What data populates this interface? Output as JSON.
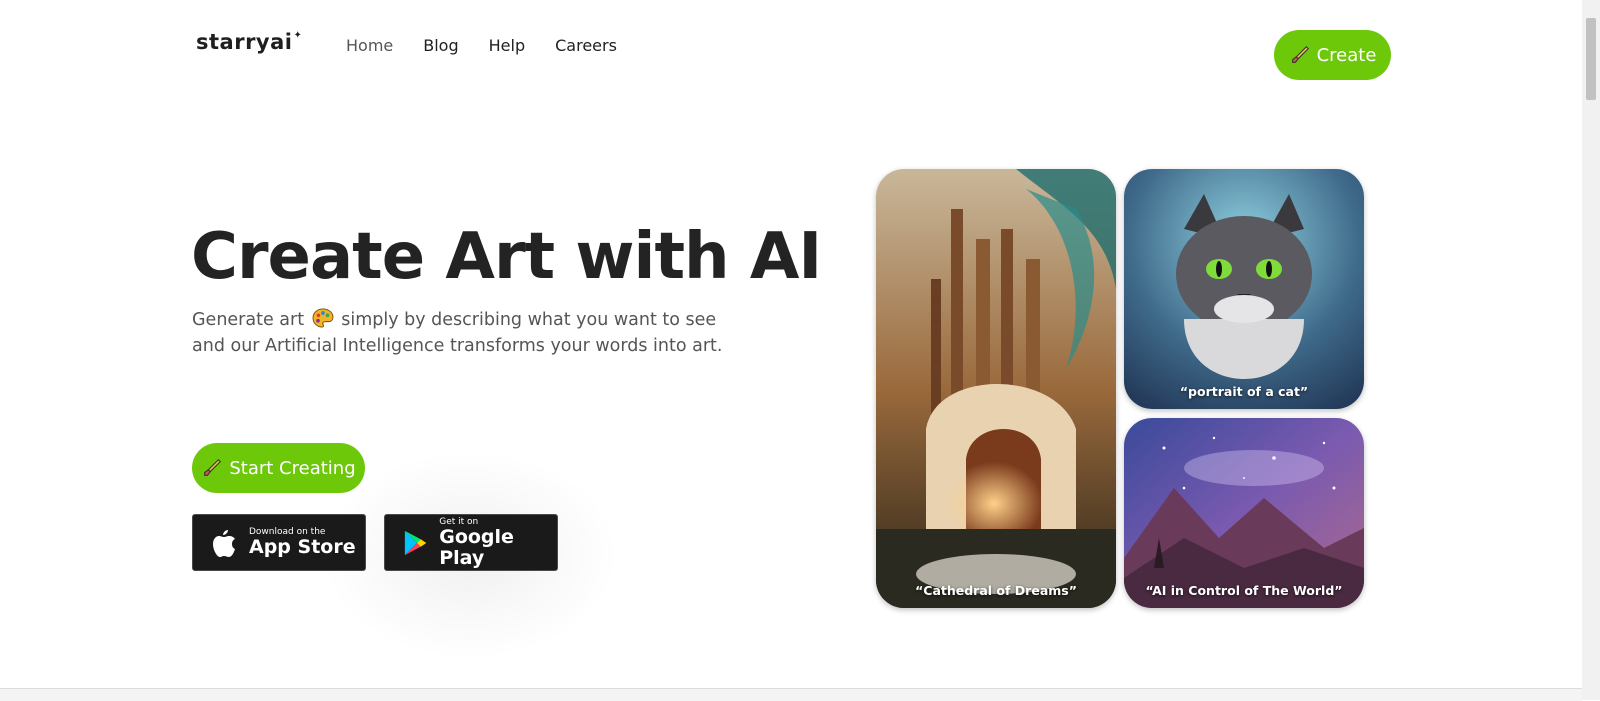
{
  "brand": {
    "name": "starryai",
    "star": "✦"
  },
  "nav": {
    "home": "Home",
    "blog": "Blog",
    "help": "Help",
    "careers": "Careers"
  },
  "header": {
    "create_label": "Create"
  },
  "hero": {
    "title": "Create Art with AI",
    "subtitle_before": "Generate art",
    "subtitle_after": "simply by describing what you want to see and our Artificial Intelligence transforms your words into art.",
    "start_label": "Start Creating"
  },
  "stores": {
    "appstore_small": "Download on the",
    "appstore_big": "App Store",
    "gplay_small": "Get it on",
    "gplay_big": "Google Play"
  },
  "gallery": {
    "cathedral_caption": "“Cathedral of Dreams”",
    "cat_caption": "“portrait of a cat”",
    "space_caption": "“AI in Control of The World”"
  },
  "colors": {
    "accent": "#6dc80a",
    "text": "#232323",
    "store_bg": "#1a1a1a"
  }
}
